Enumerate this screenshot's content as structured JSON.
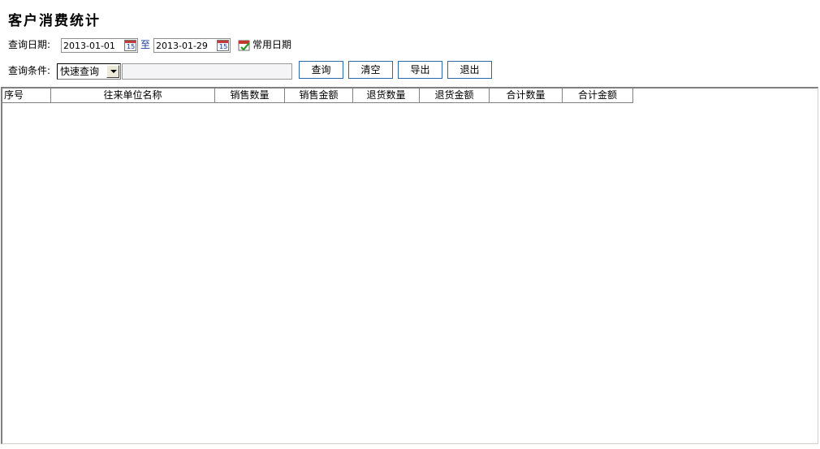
{
  "page": {
    "title": "客户消费统计"
  },
  "query": {
    "date_label": "查询日期:",
    "start_date": "2013-01-01",
    "to_label": "至",
    "end_date": "2013-01-29",
    "common_date_label": "常用日期",
    "condition_label": "查询条件:",
    "condition_selected": "快速查询",
    "keyword": ""
  },
  "toolbar": {
    "query": "查询",
    "clear": "清空",
    "export": "导出",
    "exit": "退出"
  },
  "table": {
    "columns": [
      "序号",
      "往来单位名称",
      "销售数量",
      "销售金额",
      "退货数量",
      "退货金额",
      "合计数量",
      "合计金额"
    ],
    "rows": []
  },
  "icons": {
    "calendar": "calendar-icon",
    "common_date": "calendar-check-icon",
    "dropdown": "chevron-down-icon"
  },
  "colors": {
    "button_border": "#2a6aa8",
    "grid_border": "#808080"
  }
}
